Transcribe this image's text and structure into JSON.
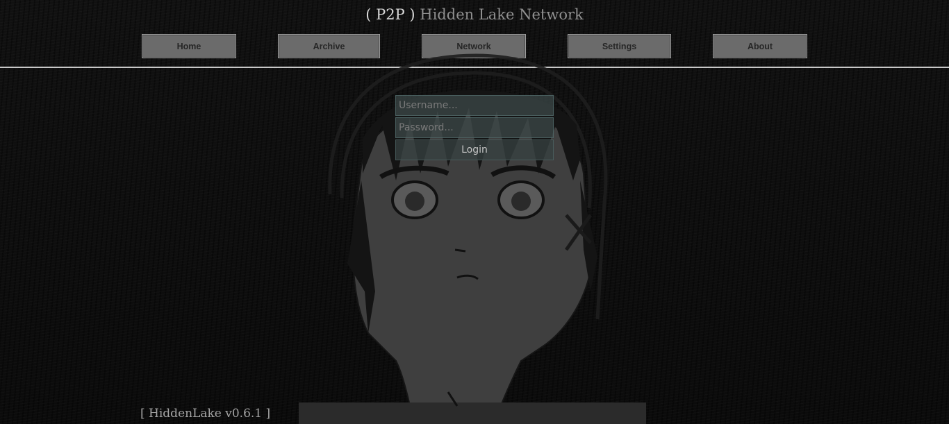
{
  "header": {
    "title_prefix": "( P2P )",
    "title_main": "Hidden Lake Network"
  },
  "nav": {
    "items": [
      {
        "label": "Home"
      },
      {
        "label": "Archive"
      },
      {
        "label": "Network"
      },
      {
        "label": "Settings"
      },
      {
        "label": "About"
      }
    ]
  },
  "login": {
    "username_placeholder": "Username...",
    "username_value": "",
    "password_placeholder": "Password...",
    "password_value": "",
    "button_label": "Login"
  },
  "footer": {
    "version": "[ HiddenLake v0.6.1 ]"
  },
  "colors": {
    "background": "#0d0d0d",
    "nav_button": "#6b6b6b",
    "divider": "#c8c8c8"
  }
}
